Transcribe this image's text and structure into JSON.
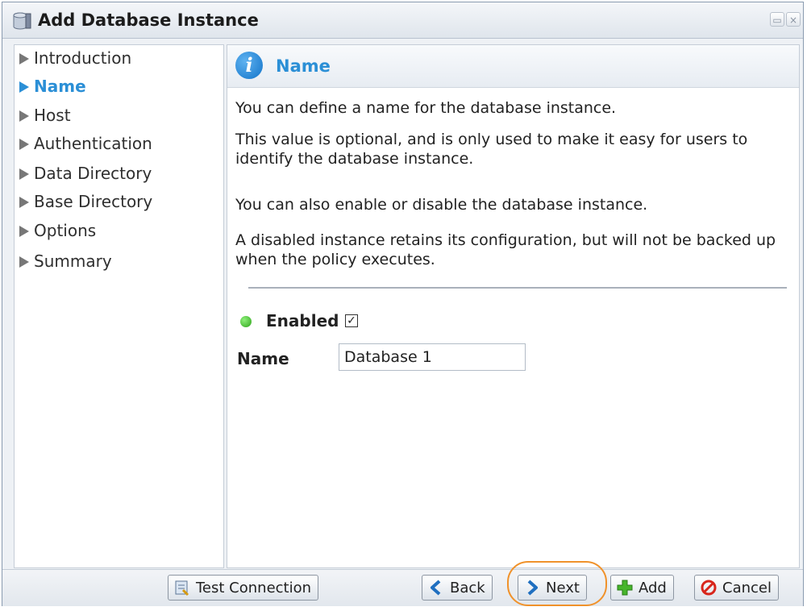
{
  "window": {
    "title": "Add Database Instance"
  },
  "nav": {
    "items": [
      {
        "label": "Introduction",
        "active": false
      },
      {
        "label": "Name",
        "active": true
      },
      {
        "label": "Host",
        "active": false
      },
      {
        "label": "Authentication",
        "active": false
      },
      {
        "label": "Data Directory",
        "active": false
      },
      {
        "label": "Base Directory",
        "active": false
      },
      {
        "label": "Options",
        "active": false
      },
      {
        "label": "Summary",
        "active": false
      }
    ]
  },
  "content": {
    "title": "Name",
    "paragraphs": [
      "You can define a name for the database instance.",
      "This value is optional, and is only used to make it easy for users to identify the database instance.",
      "You can also enable or disable the database instance.",
      "A disabled instance retains its configuration, but will not be backed up when the policy executes."
    ],
    "enabled_label": "Enabled",
    "enabled_checked": true,
    "name_label": "Name",
    "name_value": "Database 1"
  },
  "footer": {
    "test_connection": "Test Connection",
    "back": "Back",
    "next": "Next",
    "add": "Add",
    "cancel": "Cancel"
  },
  "colors": {
    "accent": "#2b8fd6",
    "highlight": "#f0922b",
    "status_green": "#2ea31a"
  }
}
